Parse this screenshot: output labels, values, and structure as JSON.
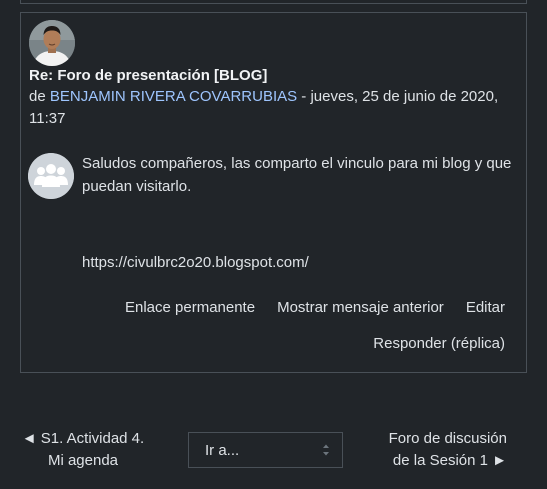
{
  "post": {
    "subject": "Re: Foro de presentación [BLOG]",
    "by_prefix": "de ",
    "author": "BENJAMIN RIVERA COVARRUBIAS",
    "date_text": " - jueves, 25 de junio de 2020, 11:37",
    "message": "Saludos compañeros, las comparto el vinculo para mi blog y que puedan visitarlo.",
    "url": "https://civulbrc2o20.blogspot.com/",
    "actions": [
      "Enlace permanente",
      "Mostrar mensaje anterior",
      "Editar"
    ],
    "reply": "Responder (réplica)"
  },
  "nav": {
    "prev_line1": "◄ S1. Actividad 4.",
    "prev_line2": "Mi agenda",
    "jump_label": "Ir a...",
    "next_line1": "Foro de discusión",
    "next_line2": "de la Sesión 1 ►"
  }
}
